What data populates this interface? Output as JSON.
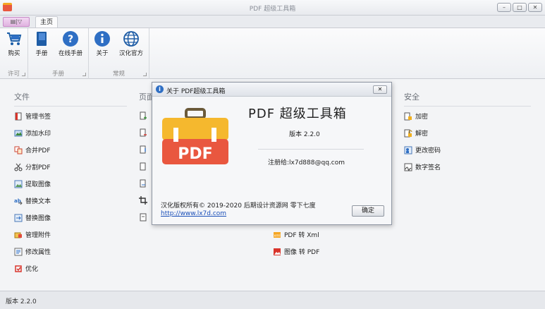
{
  "window": {
    "title": "PDF 超级工具箱",
    "controls": [
      "minimize-icon",
      "maximize-icon",
      "close-icon"
    ]
  },
  "ribbon": {
    "quick_access_label": "▤|▽",
    "tabs": [
      {
        "label": "主页"
      }
    ],
    "groups": [
      {
        "label": "许可",
        "buttons": [
          {
            "label": "购买",
            "icon": "cart-icon"
          }
        ]
      },
      {
        "label": "手册",
        "buttons": [
          {
            "label": "手册",
            "icon": "book-icon"
          },
          {
            "label": "在线手册",
            "icon": "help-icon"
          }
        ]
      },
      {
        "label": "常规",
        "buttons": [
          {
            "label": "关于",
            "icon": "info-icon"
          },
          {
            "label": "汉化官方",
            "icon": "globe-icon"
          }
        ]
      }
    ]
  },
  "sections": {
    "file": {
      "title": "文件",
      "items": [
        "管理书签",
        "添加水印",
        "合并PDF",
        "分割PDF",
        "提取图像",
        "替换文本",
        "替换图像",
        "管理附件",
        "修改属性",
        "优化"
      ]
    },
    "page": {
      "title": "页面"
    },
    "convert": {
      "items": [
        "PDF 转 Xml",
        "图像 转 PDF"
      ]
    },
    "security": {
      "title": "安全",
      "items": [
        "加密",
        "解密",
        "更改密码",
        "数字签名"
      ]
    }
  },
  "status": {
    "version": "版本 2.2.0"
  },
  "about_dialog": {
    "title": "关于 PDF超级工具箱",
    "close_label": "✕",
    "app_name": "PDF 超级工具箱",
    "version": "版本 2.2.0",
    "registered": "注册给:lx7d888@qq.com",
    "logo_text": "PDF",
    "copyright": "汉化版权所有© 2019-2020 后期设计资源网 零下七度",
    "link": "http://www.lx7d.com",
    "ok_label": "确定"
  },
  "colors": {
    "accent": "#2f6fc4",
    "logo_red": "#e9573f",
    "logo_yellow": "#f5b82e",
    "link": "#1a4fb8"
  }
}
